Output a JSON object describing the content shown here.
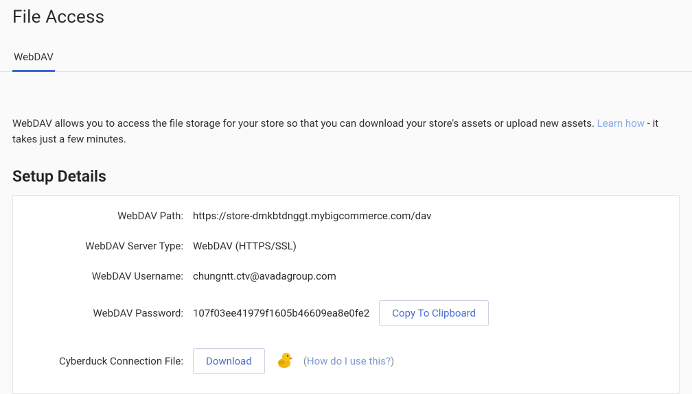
{
  "pageTitle": "File Access",
  "tabs": {
    "webdav": {
      "label": "WebDAV"
    }
  },
  "intro": {
    "part1": "WebDAV allows you to access the file storage for your store so that you can download your store's assets or upload new assets. ",
    "linkText": "Learn how",
    "part2": " - it takes just a few minutes."
  },
  "sectionHeading": "Setup Details",
  "fields": {
    "path": {
      "label": "WebDAV Path:",
      "value": "https://store-dmkbtdnggt.mybigcommerce.com/dav"
    },
    "serverType": {
      "label": "WebDAV Server Type:",
      "value": "WebDAV (HTTPS/SSL)"
    },
    "username": {
      "label": "WebDAV Username:",
      "value": "chungntt.ctv@avadagroup.com"
    },
    "password": {
      "label": "WebDAV Password:",
      "value": "107f03ee41979f1605b46609ea8e0fe2"
    },
    "connectionFile": {
      "label": "Cyberduck Connection File:"
    }
  },
  "buttons": {
    "copy": "Copy To Clipboard",
    "download": "Download"
  },
  "links": {
    "howUse": "How do I use this?"
  }
}
